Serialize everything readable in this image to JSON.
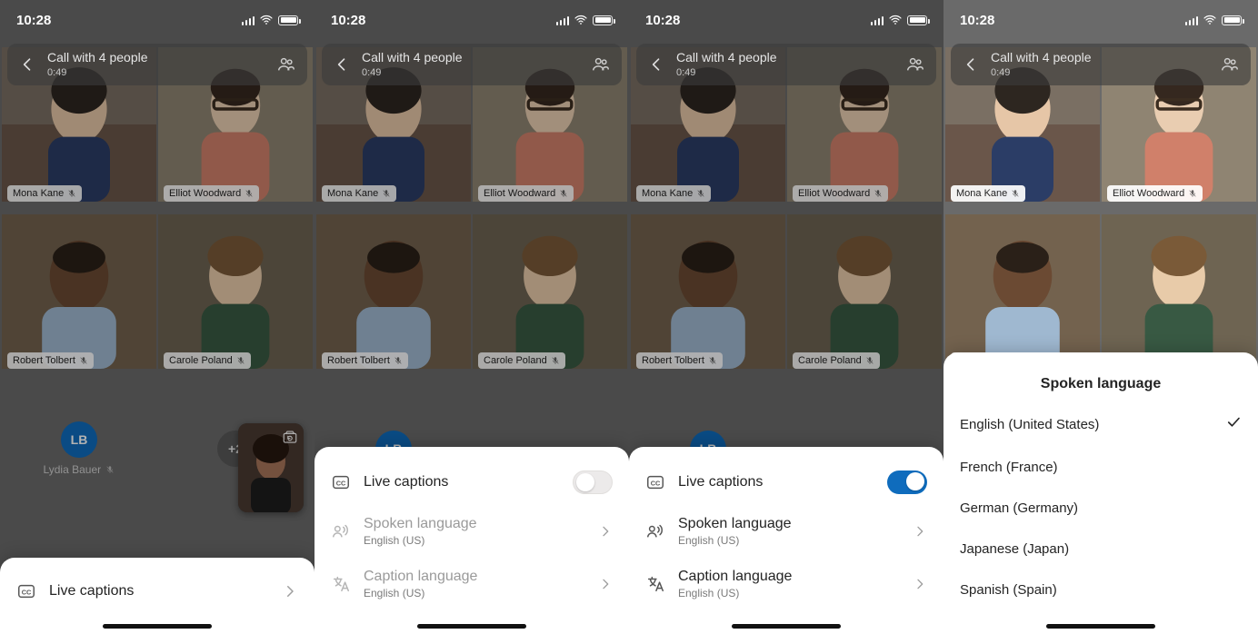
{
  "statusbar": {
    "time": "10:28"
  },
  "header": {
    "title": "Call with 4 people",
    "duration": "0:49"
  },
  "participants": {
    "tiles": [
      {
        "name": "Mona Kane"
      },
      {
        "name": "Elliot Woodward"
      },
      {
        "name": "Robert Tolbert"
      },
      {
        "name": "Carole Poland"
      }
    ],
    "avatar": {
      "initials": "LB",
      "name": "Lydia Bauer"
    },
    "overflow": "+2"
  },
  "sheet_plain": {
    "live_captions": "Live captions"
  },
  "sheet_off": {
    "live_captions": "Live captions",
    "spoken_label": "Spoken language",
    "spoken_value": "English (US)",
    "caption_label": "Caption language",
    "caption_value": "English (US)"
  },
  "sheet_on": {
    "live_captions": "Live captions",
    "spoken_label": "Spoken language",
    "spoken_value": "English (US)",
    "caption_label": "Caption language",
    "caption_value": "English (US)"
  },
  "language_sheet": {
    "title": "Spoken language",
    "options": [
      "English (United States)",
      "French (France)",
      "German (Germany)",
      "Japanese (Japan)",
      "Spanish (Spain)"
    ],
    "selected_index": 0
  }
}
